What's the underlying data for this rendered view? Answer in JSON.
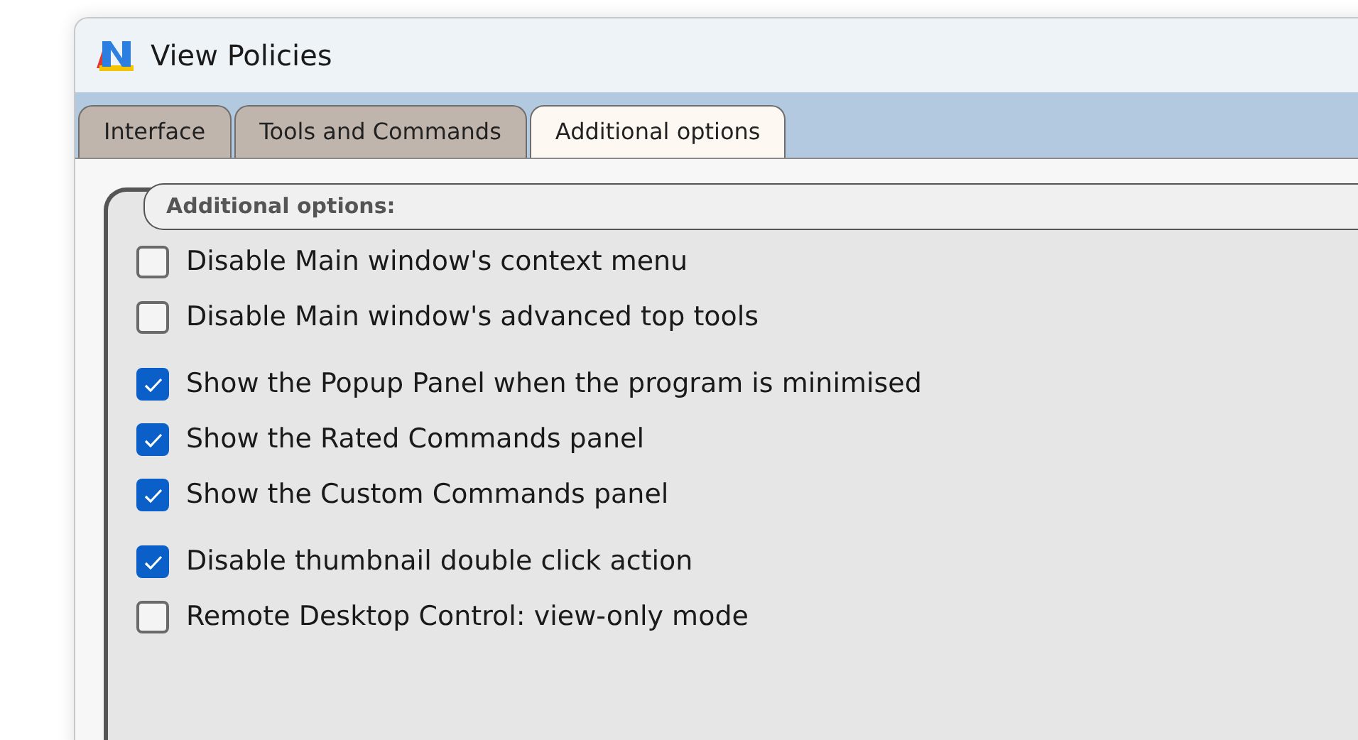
{
  "window": {
    "title": "View Policies"
  },
  "tabs": [
    {
      "label": "Interface",
      "selected": false
    },
    {
      "label": "Tools and Commands",
      "selected": false
    },
    {
      "label": "Additional options",
      "selected": true
    }
  ],
  "group": {
    "title": "Additional options:",
    "sections": [
      [
        {
          "label": "Disable Main window's context menu",
          "checked": false
        },
        {
          "label": "Disable Main window's advanced top tools",
          "checked": false
        }
      ],
      [
        {
          "label": "Show the Popup Panel when the program is minimised",
          "checked": true
        },
        {
          "label": "Show the Rated Commands panel",
          "checked": true
        },
        {
          "label": "Show the Custom Commands panel",
          "checked": true
        }
      ],
      [
        {
          "label": "Disable thumbnail double click action",
          "checked": true
        },
        {
          "label": "Remote Desktop Control: view-only mode",
          "checked": false
        }
      ]
    ]
  }
}
